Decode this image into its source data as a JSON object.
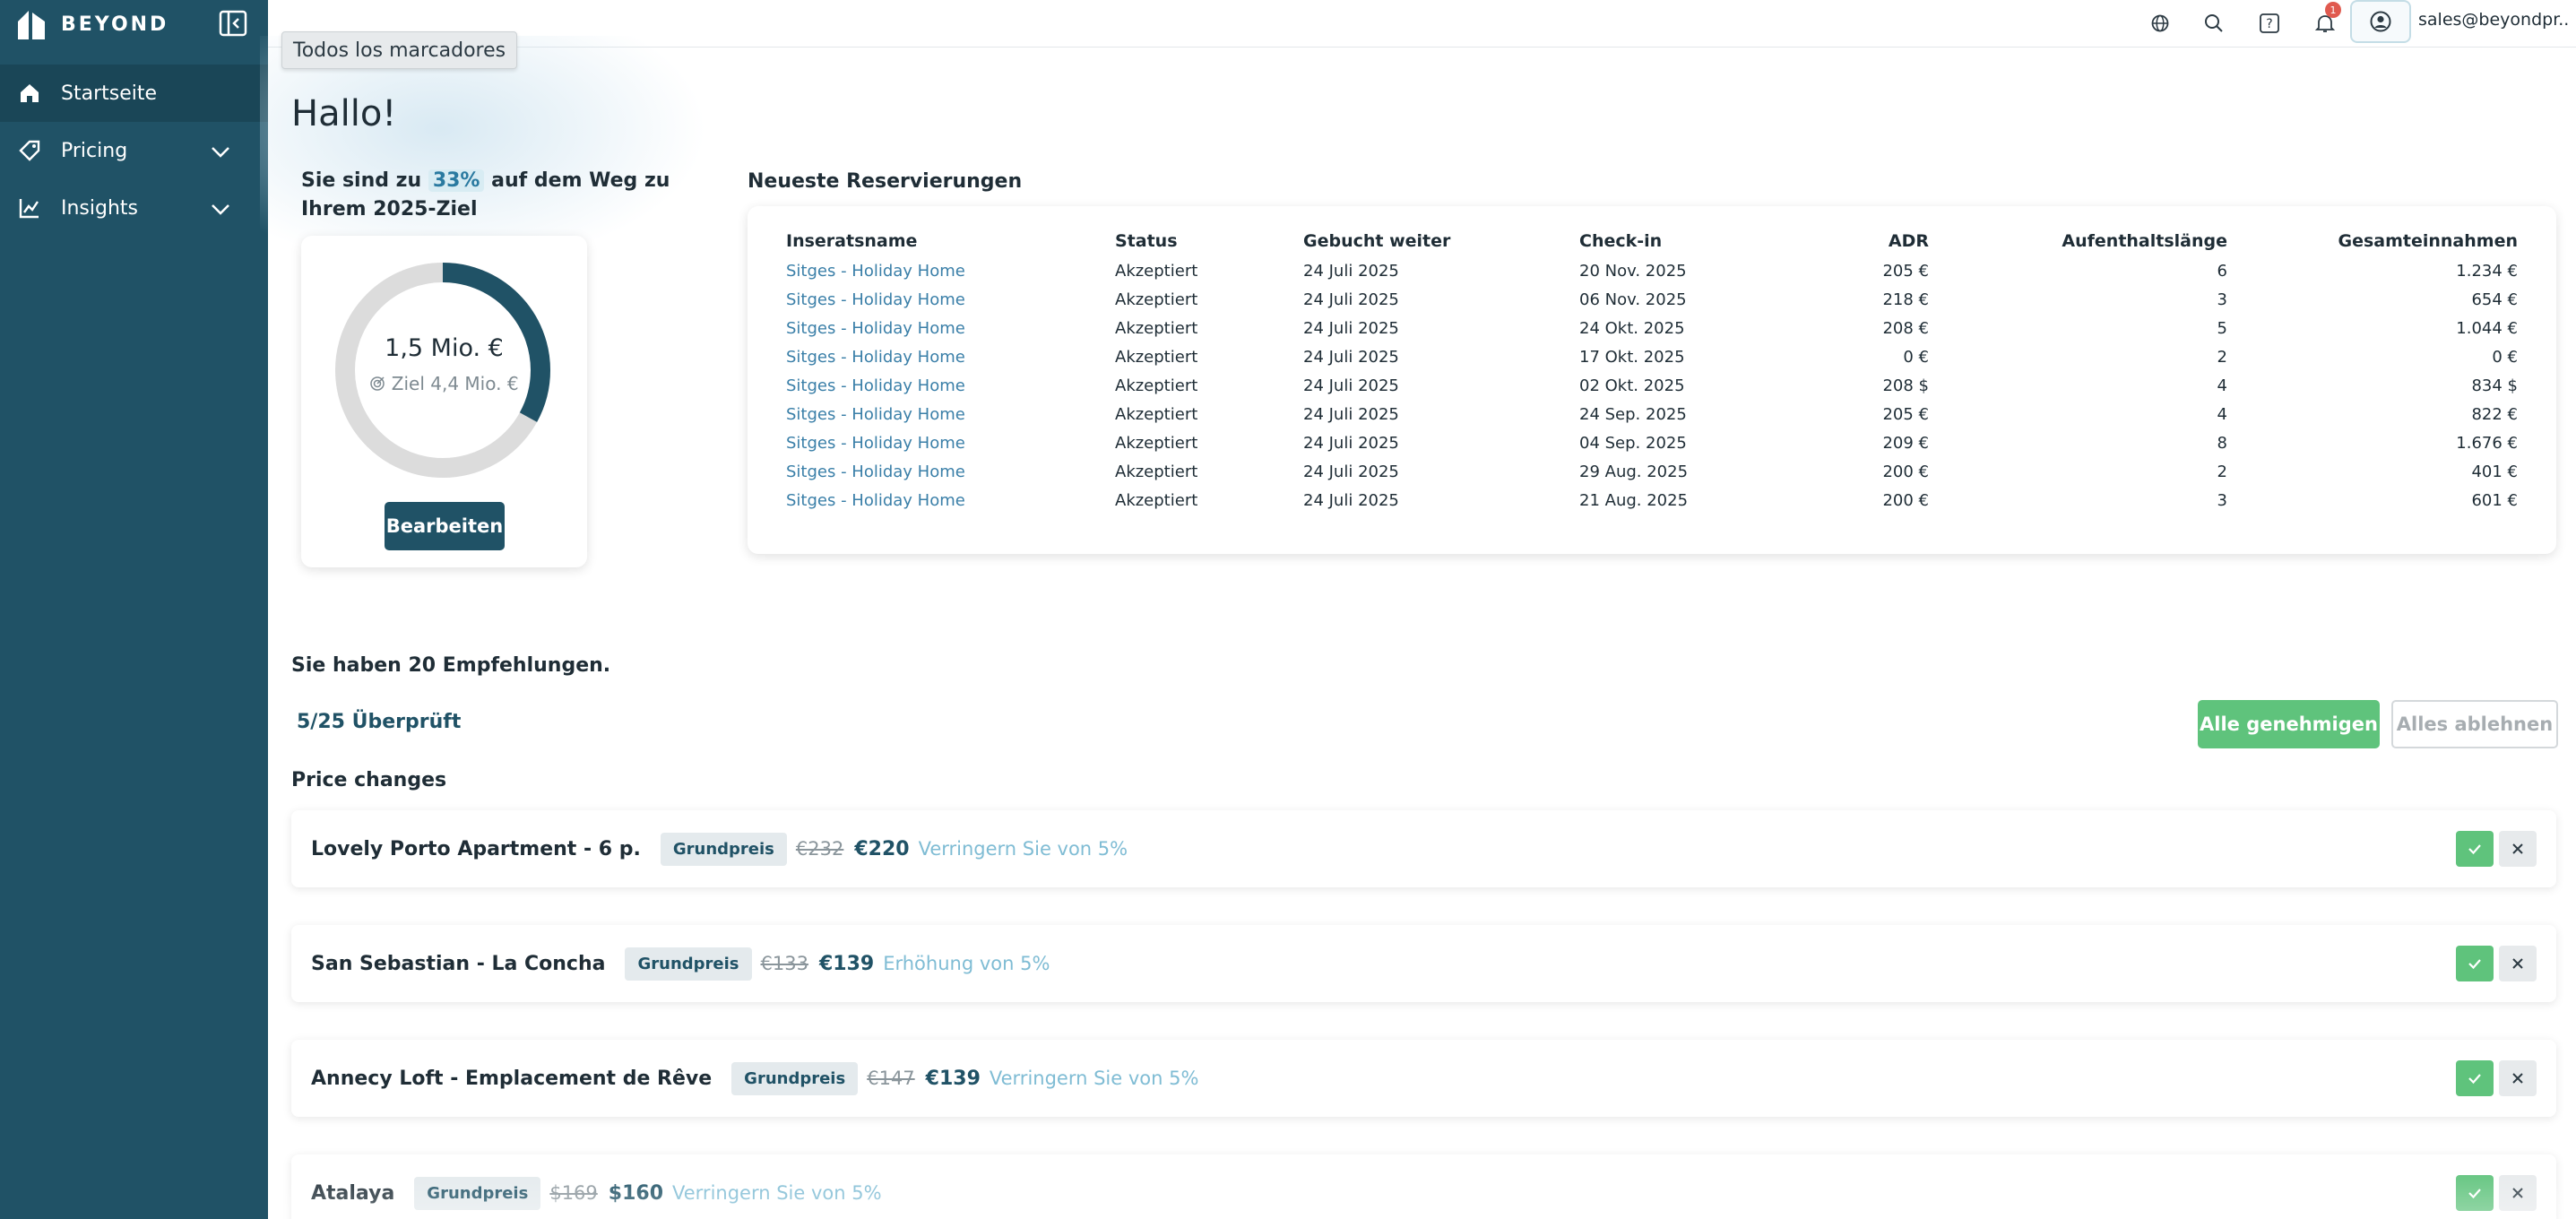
{
  "brand": {
    "name": "BEYOND"
  },
  "sidebar": {
    "items": [
      {
        "label": "Startseite",
        "icon": "home-icon",
        "active": true
      },
      {
        "label": "Pricing",
        "icon": "price-tag-icon",
        "expandable": true
      },
      {
        "label": "Insights",
        "icon": "chart-icon",
        "expandable": true
      }
    ]
  },
  "topbar": {
    "icons": [
      "globe-icon",
      "search-icon",
      "help-icon",
      "bell-icon",
      "user-icon"
    ],
    "notification_count": "1",
    "user_email": "sales@beyondpr..."
  },
  "tooltip": "Todos los marcadores",
  "greeting": "Hallo!",
  "goal": {
    "text_before": "Sie sind zu",
    "percent": "33%",
    "text_after": "auf dem Weg zu Ihrem 2025-Ziel",
    "progress_fraction": 0.33,
    "value": "1,5 Mio. €",
    "target": "Ziel 4,4 Mio. €",
    "edit_label": "Bearbeiten"
  },
  "reservations": {
    "title": "Neueste Reservierungen",
    "columns": [
      "Inseratsname",
      "Status",
      "Gebucht weiter",
      "Check-in",
      "ADR",
      "Aufenthaltslänge",
      "Gesamteinnahmen"
    ],
    "rows": [
      [
        "Sitges - Holiday Home",
        "Akzeptiert",
        "24 Juli 2025",
        "20 Nov. 2025",
        "205 €",
        "6",
        "1.234 €"
      ],
      [
        "Sitges - Holiday Home",
        "Akzeptiert",
        "24 Juli 2025",
        "06 Nov. 2025",
        "218 €",
        "3",
        "654 €"
      ],
      [
        "Sitges - Holiday Home",
        "Akzeptiert",
        "24 Juli 2025",
        "24 Okt. 2025",
        "208 €",
        "5",
        "1.044 €"
      ],
      [
        "Sitges - Holiday Home",
        "Akzeptiert",
        "24 Juli 2025",
        "17 Okt. 2025",
        "0 €",
        "2",
        "0 €"
      ],
      [
        "Sitges - Holiday Home",
        "Akzeptiert",
        "24 Juli 2025",
        "02 Okt. 2025",
        "208 $",
        "4",
        "834 $"
      ],
      [
        "Sitges - Holiday Home",
        "Akzeptiert",
        "24 Juli 2025",
        "24 Sep. 2025",
        "205 €",
        "4",
        "822 €"
      ],
      [
        "Sitges - Holiday Home",
        "Akzeptiert",
        "24 Juli 2025",
        "04 Sep. 2025",
        "209 €",
        "8",
        "1.676 €"
      ],
      [
        "Sitges - Holiday Home",
        "Akzeptiert",
        "24 Juli 2025",
        "29 Aug. 2025",
        "200 €",
        "2",
        "401 €"
      ],
      [
        "Sitges - Holiday Home",
        "Akzeptiert",
        "24 Juli 2025",
        "21 Aug. 2025",
        "200 €",
        "3",
        "601 €"
      ]
    ]
  },
  "recommendations": {
    "title": "Sie haben 20 Empfehlungen.",
    "reviewed": "5/25 Überprüft",
    "approve_all": "Alle genehmigen",
    "reject_all": "Alles ablehnen",
    "section_title": "Price changes",
    "items": [
      {
        "name": "Lovely Porto Apartment - 6 p.",
        "tag": "Grundpreis",
        "old": "€232",
        "new": "€220",
        "note": "Verringern Sie von 5%"
      },
      {
        "name": "San Sebastian - La Concha",
        "tag": "Grundpreis",
        "old": "€133",
        "new": "€139",
        "note": "Erhöhung von 5%"
      },
      {
        "name": "Annecy Loft - Emplacement de Rêve",
        "tag": "Grundpreis",
        "old": "€147",
        "new": "€139",
        "note": "Verringern Sie von 5%"
      },
      {
        "name": "Atalaya",
        "tag": "Grundpreis",
        "old": "$169",
        "new": "$160",
        "note": "Verringern Sie von 5%"
      }
    ]
  },
  "colors": {
    "sidebar": "#205266",
    "accent": "#205266",
    "approve": "#5fc37c",
    "note": "#7fbcd4"
  }
}
